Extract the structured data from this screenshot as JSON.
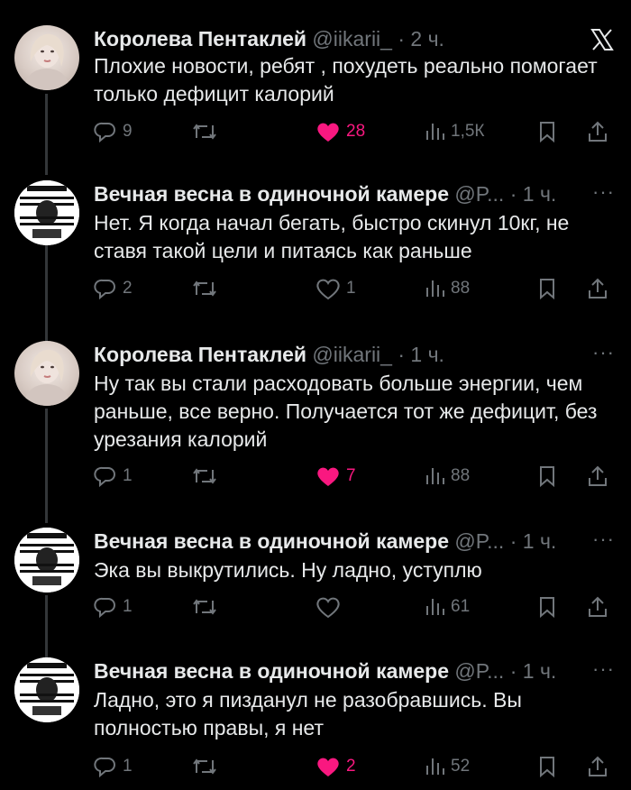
{
  "tweets": [
    {
      "author": "Королева Пентаклей",
      "handle": "@iikarii_",
      "time": "· 2 ч.",
      "text": "Плохие новости, ребят , похудеть реально помогает только дефицит калорий",
      "replies": "9",
      "retweets": "",
      "likes": "28",
      "liked": true,
      "views": "1,5К"
    },
    {
      "author": "Вечная весна в одиночной камере",
      "handle": "@P...",
      "time": "· 1 ч.",
      "text": "Нет. Я когда начал бегать, быстро скинул 10кг, не ставя такой цели и питаясь как раньше",
      "replies": "2",
      "retweets": "",
      "likes": "1",
      "liked": false,
      "views": "88"
    },
    {
      "author": "Королева Пентаклей",
      "handle": "@iikarii_",
      "time": "· 1 ч.",
      "text": "Ну так вы стали расходовать больше энергии, чем раньше, все верно. Получается тот же дефицит, без урезания калорий",
      "replies": "1",
      "retweets": "",
      "likes": "7",
      "liked": true,
      "views": "88"
    },
    {
      "author": "Вечная весна в одиночной камере",
      "handle": "@P...",
      "time": "· 1 ч.",
      "text": "Эка вы выкрутились. Ну ладно, уступлю",
      "replies": "1",
      "retweets": "",
      "likes": "",
      "liked": false,
      "views": "61"
    },
    {
      "author": "Вечная весна в одиночной камере",
      "handle": "@P...",
      "time": "· 1 ч.",
      "text": "Ладно, это я пизданул не разобравшись. Вы полностью правы, я нет",
      "replies": "1",
      "retweets": "",
      "likes": "2",
      "liked": true,
      "views": "52"
    }
  ],
  "more_symbol": "···",
  "colors": {
    "background": "#000000",
    "text": "#e7e9ea",
    "muted": "#71767b",
    "like": "#f91880",
    "line": "#333639"
  },
  "icons": [
    "x-logo-icon",
    "reply-icon",
    "retweet-icon",
    "heart-icon",
    "views-icon",
    "bookmark-icon",
    "share-icon",
    "more-icon"
  ]
}
